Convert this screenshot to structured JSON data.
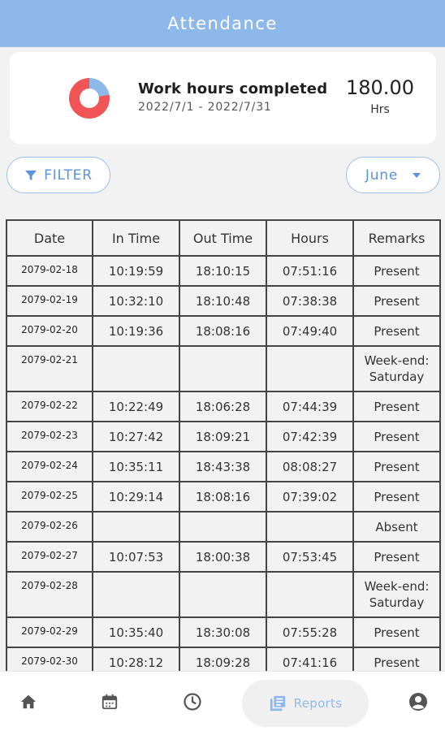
{
  "header": {
    "title": "Attendance"
  },
  "summary": {
    "label": "Work hours completed",
    "range": "2022/7/1 - 2022/7/31",
    "value": "180.00",
    "unit": "Hrs"
  },
  "filter": {
    "label": "FILTER"
  },
  "month_select": {
    "selected": "June"
  },
  "table": {
    "columns": [
      "Date",
      "In Time",
      "Out Time",
      "Hours",
      "Remarks"
    ],
    "rows": [
      [
        "2079-02-18",
        "10:19:59",
        "18:10:15",
        "07:51:16",
        "Present"
      ],
      [
        "2079-02-19",
        "10:32:10",
        "18:10:48",
        "07:38:38",
        "Present"
      ],
      [
        "2079-02-20",
        "10:19:36",
        "18:08:16",
        "07:49:40",
        "Present"
      ],
      [
        "2079-02-21",
        "",
        "",
        "",
        "Week-end: Saturday"
      ],
      [
        "2079-02-22",
        "10:22:49",
        "18:06:28",
        "07:44:39",
        "Present"
      ],
      [
        "2079-02-23",
        "10:27:42",
        "18:09:21",
        "07:42:39",
        "Present"
      ],
      [
        "2079-02-24",
        "10:35:11",
        "18:43:38",
        "08:08:27",
        "Present"
      ],
      [
        "2079-02-25",
        "10:29:14",
        "18:08:16",
        "07:39:02",
        "Present"
      ],
      [
        "2079-02-26",
        "",
        "",
        "",
        "Absent"
      ],
      [
        "2079-02-27",
        "10:07:53",
        "18:00:38",
        "07:53:45",
        "Present"
      ],
      [
        "2079-02-28",
        "",
        "",
        "",
        "Week-end: Saturday"
      ],
      [
        "2079-02-29",
        "10:35:40",
        "18:30:08",
        "07:55:28",
        "Present"
      ],
      [
        "2079-02-30",
        "10:28:12",
        "18:09:28",
        "07:41:16",
        "Present"
      ]
    ]
  },
  "nav": {
    "items": [
      {
        "icon": "home-icon"
      },
      {
        "icon": "calendar-icon"
      },
      {
        "icon": "clock-icon"
      },
      {
        "icon": "reports-icon",
        "label": "Reports",
        "active": true
      },
      {
        "icon": "profile-icon"
      }
    ]
  },
  "colors": {
    "header": "#8fb8ea",
    "accent": "#5b93de",
    "donut_primary": "#f05454",
    "donut_secondary": "#8fb8ea"
  }
}
